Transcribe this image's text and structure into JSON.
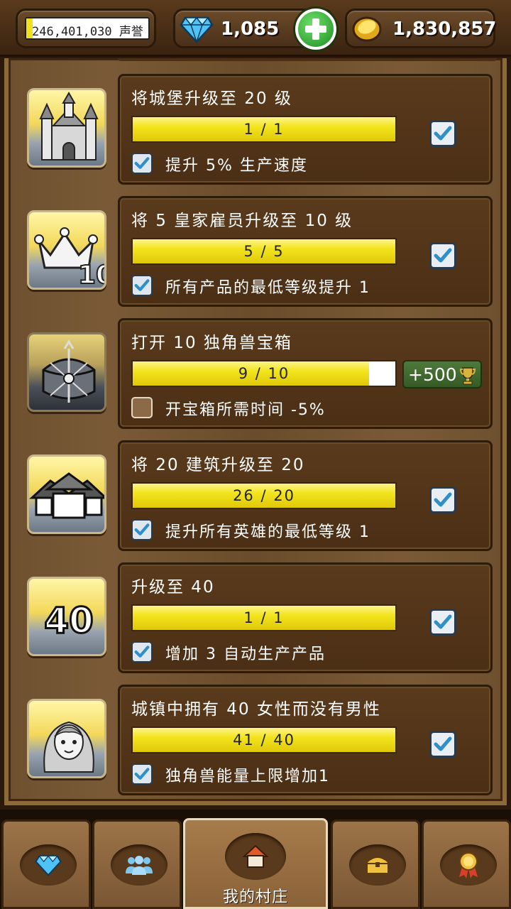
{
  "top_bar": {
    "reputation": {
      "text": "246,401,030 声誉",
      "fill_fraction": 0.05
    },
    "gems": {
      "value": "1,085",
      "icon": "diamond-icon"
    },
    "gold": {
      "value": "1,830,857",
      "icon": "gold-coin-icon"
    },
    "add_button_icon": "plus-icon"
  },
  "achievements": [
    {
      "icon": "castle-icon",
      "title": "将城堡升级至 20 级",
      "progress": "1 / 1",
      "fill": 1.0,
      "completed": true,
      "bonus": "提升 5% 生产速度",
      "bonus_checked": true
    },
    {
      "icon": "crown-10-icon",
      "title": "将 5 皇家雇员升级至 10 级",
      "progress": "5 / 5",
      "fill": 1.0,
      "completed": true,
      "bonus": "所有产品的最低等级提升 1",
      "bonus_checked": true
    },
    {
      "icon": "unicorn-chest-icon",
      "title": "打开 10 独角兽宝箱",
      "progress": "9 / 10",
      "fill": 0.9,
      "completed": false,
      "reward": "+500",
      "reward_icon": "trophy-icon",
      "bonus": "开宝箱所需时间 -5%",
      "bonus_checked": false
    },
    {
      "icon": "buildings-icon",
      "title": "将 20 建筑升级至 20",
      "progress": "26 / 20",
      "fill": 1.0,
      "completed": true,
      "bonus": "提升所有英雄的最低等级 1",
      "bonus_checked": true
    },
    {
      "icon": "level-40-icon",
      "title": "升级至 40",
      "progress": "1 / 1",
      "fill": 1.0,
      "completed": true,
      "bonus": "增加 3 自动生产产品",
      "bonus_checked": true
    },
    {
      "icon": "female-portrait-icon",
      "title": "城镇中拥有 40 女性而没有男性",
      "progress": "41 / 40",
      "fill": 1.0,
      "completed": true,
      "bonus": "独角兽能量上限增加1",
      "bonus_checked": true
    }
  ],
  "bottom_nav": [
    {
      "icon": "diamond-icon",
      "label": ""
    },
    {
      "icon": "people-icon",
      "label": ""
    },
    {
      "icon": "house-icon",
      "label": "我的村庄",
      "active": true
    },
    {
      "icon": "chest-icon",
      "label": ""
    },
    {
      "icon": "medal-icon",
      "label": ""
    }
  ],
  "colors": {
    "progress_fill": "#f2e41c",
    "reward_button": "#4d7a3a",
    "wood_dark": "#4b2f15",
    "check_tint": "#2f8fc8"
  }
}
